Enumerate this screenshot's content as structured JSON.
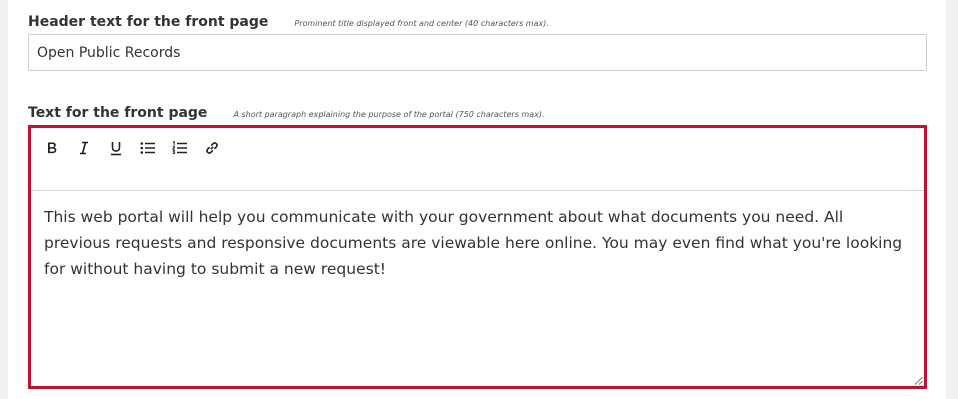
{
  "header_field": {
    "label": "Header text for the front page",
    "hint": "Prominent title displayed front and center (40 characters max).",
    "value": "Open Public Records"
  },
  "text_field": {
    "label": "Text for the front page",
    "hint": "A short paragraph explaining the purpose of the portal (750 characters max).",
    "content": "This web portal will help you communicate with your government about what documents you need. All previous requests and responsive documents are viewable here online. You may even find what you're looking for without having to submit a new request!"
  },
  "toolbar": {
    "buttons": [
      "bold-icon",
      "italic-icon",
      "underline-icon",
      "bullet-list-icon",
      "numbered-list-icon",
      "link-icon"
    ]
  },
  "colors": {
    "editor_focus_border": "#c8102e",
    "input_border": "#cfcfcf",
    "text": "#333333",
    "page_background": "#f1f1f1"
  }
}
